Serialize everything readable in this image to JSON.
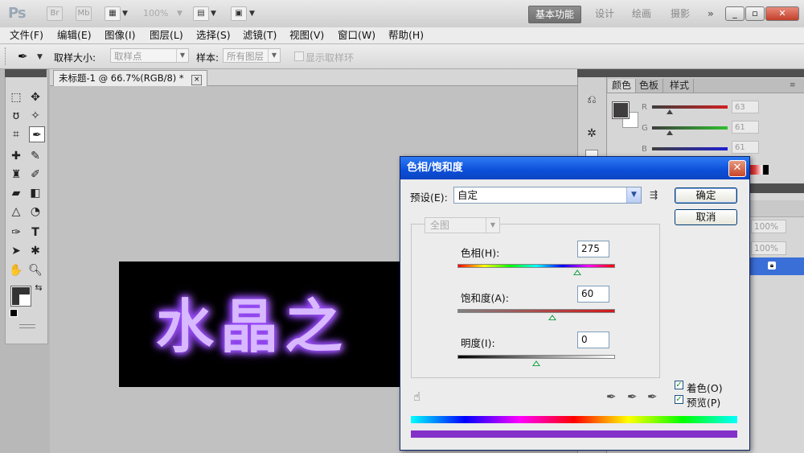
{
  "app": {
    "logo": "Ps",
    "bridge_icon": "Br",
    "minibridge_icon": "Mb",
    "zoom_level": "100%",
    "workspaces": [
      "基本功能",
      "设计",
      "绘画",
      "摄影"
    ],
    "workspace_more": "»",
    "window_controls": {
      "minimize": "_",
      "maximize": "▫",
      "close": "✕"
    }
  },
  "menu": [
    "文件(F)",
    "编辑(E)",
    "图像(I)",
    "图层(L)",
    "选择(S)",
    "滤镜(T)",
    "视图(V)",
    "窗口(W)",
    "帮助(H)"
  ],
  "options_bar": {
    "sample_size_label": "取样大小:",
    "sample_size_value": "取样点",
    "sample_label": "样本:",
    "sample_value": "所有图层",
    "show_ring_label": "显示取样环"
  },
  "document": {
    "tab_title": "未标题-1 @ 66.7%(RGB/8) *",
    "tab_close": "×",
    "canvas_text": "水晶之"
  },
  "color_panel": {
    "tabs": [
      "颜色",
      "色板",
      "样式"
    ],
    "channels": [
      {
        "name": "R",
        "value": "63",
        "color": "#cc2a2a"
      },
      {
        "name": "G",
        "value": "61",
        "color": "#2fb52f"
      },
      {
        "name": "B",
        "value": "61",
        "color": "#2a2ad0"
      }
    ]
  },
  "layers_panel": {
    "opacity": "100%",
    "fill": "100%"
  },
  "dialog": {
    "title": "色相/饱和度",
    "close": "✕",
    "preset_label": "预设(E):",
    "preset_value": "自定",
    "ok": "确定",
    "cancel": "取消",
    "edit_channel": "全图",
    "hue_label": "色相(H):",
    "hue_value": "275",
    "hue_position": 0.76,
    "saturation_label": "饱和度(A):",
    "saturation_value": "60",
    "saturation_position": 0.6,
    "lightness_label": "明度(I):",
    "lightness_value": "0",
    "lightness_position": 0.5,
    "colorize_label": "着色(O)",
    "colorize_checked": true,
    "preview_label": "预览(P)",
    "preview_checked": true
  }
}
